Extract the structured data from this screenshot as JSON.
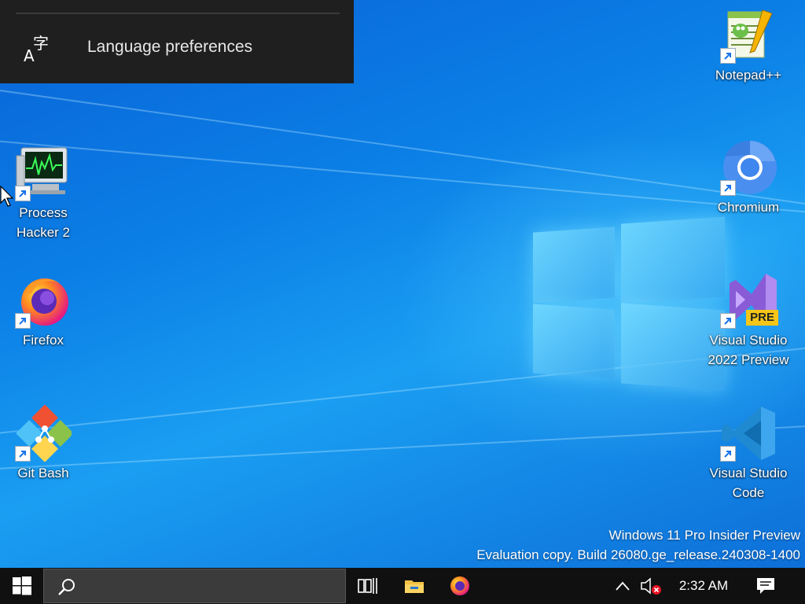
{
  "flyout": {
    "items": [
      {
        "label": "Language preferences",
        "icon": "language-icon"
      }
    ]
  },
  "desktop_icons": {
    "left": [
      {
        "label_line1": "Process",
        "label_line2": "Hacker 2",
        "icon": "process-hacker-icon"
      },
      {
        "label_line1": "Firefox",
        "label_line2": "",
        "icon": "firefox-icon"
      },
      {
        "label_line1": "Git Bash",
        "label_line2": "",
        "icon": "git-bash-icon"
      }
    ],
    "right": [
      {
        "label_line1": "Notepad++",
        "label_line2": "",
        "icon": "notepad-plus-plus-icon"
      },
      {
        "label_line1": "Chromium",
        "label_line2": "",
        "icon": "chromium-icon"
      },
      {
        "label_line1": "Visual Studio",
        "label_line2": "2022 Preview",
        "icon": "visual-studio-preview-icon",
        "badge": "PRE"
      },
      {
        "label_line1": "Visual Studio",
        "label_line2": "Code",
        "icon": "vscode-icon"
      }
    ]
  },
  "watermark": {
    "line1": "Windows 11 Pro Insider Preview",
    "line2": "Evaluation copy. Build 26080.ge_release.240308-1400"
  },
  "taskbar": {
    "clock": "2:32 AM",
    "pinned": [
      "task-view-icon",
      "file-explorer-icon",
      "firefox-icon"
    ],
    "tray": [
      "show-hidden-icons-icon",
      "volume-muted-icon",
      "action-center-icon"
    ]
  },
  "colors": {
    "desktop_blue": "#0b7fe6",
    "taskbar_bg": "#101010",
    "flyout_bg": "#1f1f1f",
    "badge_yellow": "#f5c518"
  }
}
